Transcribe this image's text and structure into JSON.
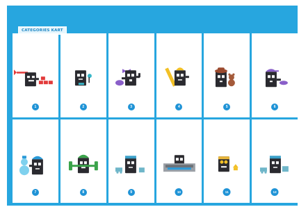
{
  "header": {
    "tag_label": "CATEGORIES KART"
  },
  "cards": [
    {
      "number": "1",
      "icon": "ninja-robot-bricks-icon"
    },
    {
      "number": "2",
      "icon": "robot-microphone-icon"
    },
    {
      "number": "3",
      "icon": "robot-bow-bag-icon"
    },
    {
      "number": "4",
      "icon": "builder-robot-ruler-icon"
    },
    {
      "number": "5",
      "icon": "robot-teddy-bear-icon"
    },
    {
      "number": "6",
      "icon": "robot-purple-cap-icon"
    },
    {
      "number": "7",
      "icon": "robot-snowman-icon"
    },
    {
      "number": "8",
      "icon": "robot-green-dumbbell-icon"
    },
    {
      "number": "9",
      "icon": "robot-train-icon"
    },
    {
      "number": "10",
      "icon": "robot-keyboard-icon"
    },
    {
      "number": "11",
      "icon": "robot-gold-yellow-icon"
    },
    {
      "number": "12",
      "icon": "robot-teal-train-icon"
    }
  ],
  "colors": {
    "background": "#27a6df",
    "card": "#ffffff",
    "badge": "#1f93d6",
    "robot": "#2a2a2f"
  }
}
